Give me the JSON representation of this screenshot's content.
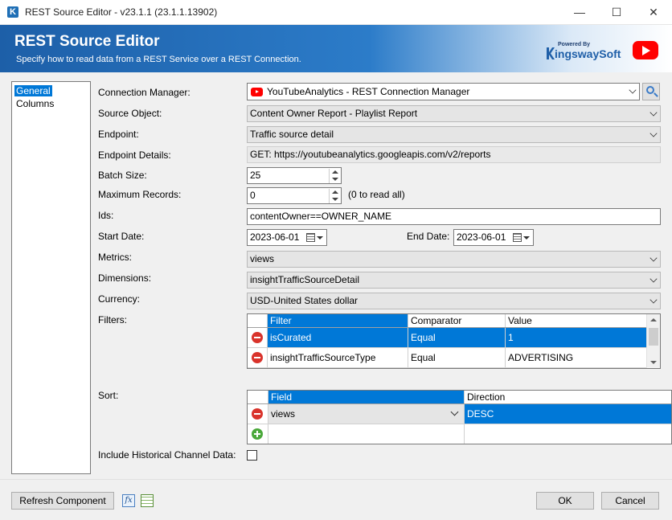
{
  "window": {
    "title": "REST Source Editor - v23.1.1 (23.1.1.13902)",
    "minimize": "—",
    "maximize": "☐",
    "close": "✕"
  },
  "banner": {
    "title": "REST Source Editor",
    "subtitle": "Specify how to read data from a REST Service over a REST Connection.",
    "brand_powered": "Powered By",
    "brand_name": "ingswaySoft"
  },
  "nav": {
    "items": [
      {
        "label": "General",
        "selected": true
      },
      {
        "label": "Columns",
        "selected": false
      }
    ]
  },
  "form": {
    "connection_manager": {
      "label": "Connection Manager:",
      "value": "YouTubeAnalytics - REST Connection Manager"
    },
    "source_object": {
      "label": "Source Object:",
      "value": "Content Owner Report - Playlist Report"
    },
    "endpoint": {
      "label": "Endpoint:",
      "value": "Traffic source detail"
    },
    "endpoint_details": {
      "label": "Endpoint Details:",
      "value": "GET: https://youtubeanalytics.googleapis.com/v2/reports"
    },
    "batch_size": {
      "label": "Batch Size:",
      "value": "25"
    },
    "max_records": {
      "label": "Maximum Records:",
      "value": "0",
      "hint": "(0 to read all)"
    },
    "ids": {
      "label": "Ids:",
      "value": "contentOwner==OWNER_NAME"
    },
    "start_date": {
      "label": "Start Date:",
      "value": "2023-06-01"
    },
    "end_date": {
      "label": "End Date:",
      "value": "2023-06-01"
    },
    "metrics": {
      "label": "Metrics:",
      "value": "views"
    },
    "dimensions": {
      "label": "Dimensions:",
      "value": "insightTrafficSourceDetail"
    },
    "currency": {
      "label": "Currency:",
      "value": "USD-United States dollar"
    },
    "filters_label": "Filters:",
    "sort_label": "Sort:",
    "historical_label": "Include Historical Channel Data:"
  },
  "filters": {
    "columns": [
      "Filter",
      "Comparator",
      "Value"
    ],
    "rows": [
      {
        "filter": "isCurated",
        "comparator": "Equal",
        "value": "1",
        "selected": true
      },
      {
        "filter": "insightTrafficSourceType",
        "comparator": "Equal",
        "value": "ADVERTISING",
        "selected": false
      }
    ]
  },
  "sort": {
    "columns": [
      "Field",
      "Direction"
    ],
    "rows": [
      {
        "field": "views",
        "direction": "DESC"
      }
    ]
  },
  "footer": {
    "refresh": "Refresh Component",
    "fx": "fx",
    "ok": "OK",
    "cancel": "Cancel"
  }
}
